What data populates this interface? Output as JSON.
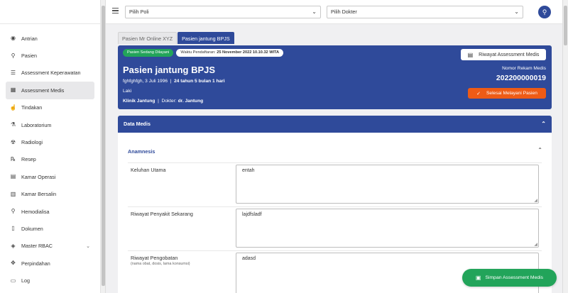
{
  "sidebar": {
    "items": [
      {
        "label": "Antrian",
        "icon": "disc-icon",
        "glyph": "◉"
      },
      {
        "label": "Pasien",
        "icon": "user-icon",
        "glyph": "⚲"
      },
      {
        "label": "Assessment Keperawatan",
        "icon": "list-icon",
        "glyph": "☰"
      },
      {
        "label": "Assessment Medis",
        "icon": "table-icon",
        "glyph": "▦"
      },
      {
        "label": "Tindakan",
        "icon": "hand-icon",
        "glyph": "☝"
      },
      {
        "label": "Laboratorium",
        "icon": "lab-icon",
        "glyph": "⚗"
      },
      {
        "label": "Radiologi",
        "icon": "radiology-icon",
        "glyph": "☢"
      },
      {
        "label": "Resep",
        "icon": "prescription-icon",
        "glyph": "℞"
      },
      {
        "label": "Kamar Operasi",
        "icon": "operating-room-icon",
        "glyph": "▤"
      },
      {
        "label": "Kamar Bersalin",
        "icon": "delivery-room-icon",
        "glyph": "▥"
      },
      {
        "label": "Hemodialisa",
        "icon": "person-icon",
        "glyph": "⚲"
      },
      {
        "label": "Dokumen",
        "icon": "document-icon",
        "glyph": "▯"
      },
      {
        "label": "Master RBAC",
        "icon": "shield-icon",
        "glyph": "◈"
      },
      {
        "label": "Perpindahan",
        "icon": "move-icon",
        "glyph": "✥"
      },
      {
        "label": "Log",
        "icon": "log-icon",
        "glyph": "▭"
      }
    ],
    "active_index": 3
  },
  "topbar": {
    "poli_select": "Pilih Poli",
    "dokter_select": "Pilih Dokter",
    "avatar_glyph": "⚲"
  },
  "tabs": [
    {
      "label": "Pasien Mr Online XYZ",
      "active": false
    },
    {
      "label": "Pasien jantung BPJS",
      "active": true
    }
  ],
  "patient": {
    "status_badge": "Pasien Sedang Dilayani",
    "registration_label": "Waktu Pendaftaran:",
    "registration_time": "25 November 2022 10.10.32 WITA",
    "name": "Pasien jantung BPJS",
    "birth_place_date": "fghfghfgh, 3 Juli 1996",
    "age": "24 tahun 5 bulan 1 hari",
    "gender": "Laki",
    "clinic": "Klinik Jantung",
    "doctor_label": "Dokter:",
    "doctor": "dr. Jantung",
    "medical_record_label": "Nomor Rekam Medis",
    "medical_record_number": "202200000019",
    "riwayat_button": "Riwayat Assessment Medis",
    "selesai_button": "Selesai Melayani Pasien"
  },
  "data_medis": {
    "header": "Data Medis",
    "section_title": "Anamnesis",
    "fields": [
      {
        "label": "Keluhan Utama",
        "sublabel": "",
        "value": "entah"
      },
      {
        "label": "Riwayat Penyakit Sekarang",
        "sublabel": "",
        "value": "lajdfsladf"
      },
      {
        "label": "Riwayat Pengobatan",
        "sublabel": "(nama obat, dosis, lama konsumsi)",
        "value": "adasd"
      }
    ]
  },
  "footer": {
    "save_button": "Simpan Assessment Medis"
  },
  "colors": {
    "primary": "#2f4a9a",
    "success": "#22a45a",
    "danger": "#ee5b16"
  }
}
